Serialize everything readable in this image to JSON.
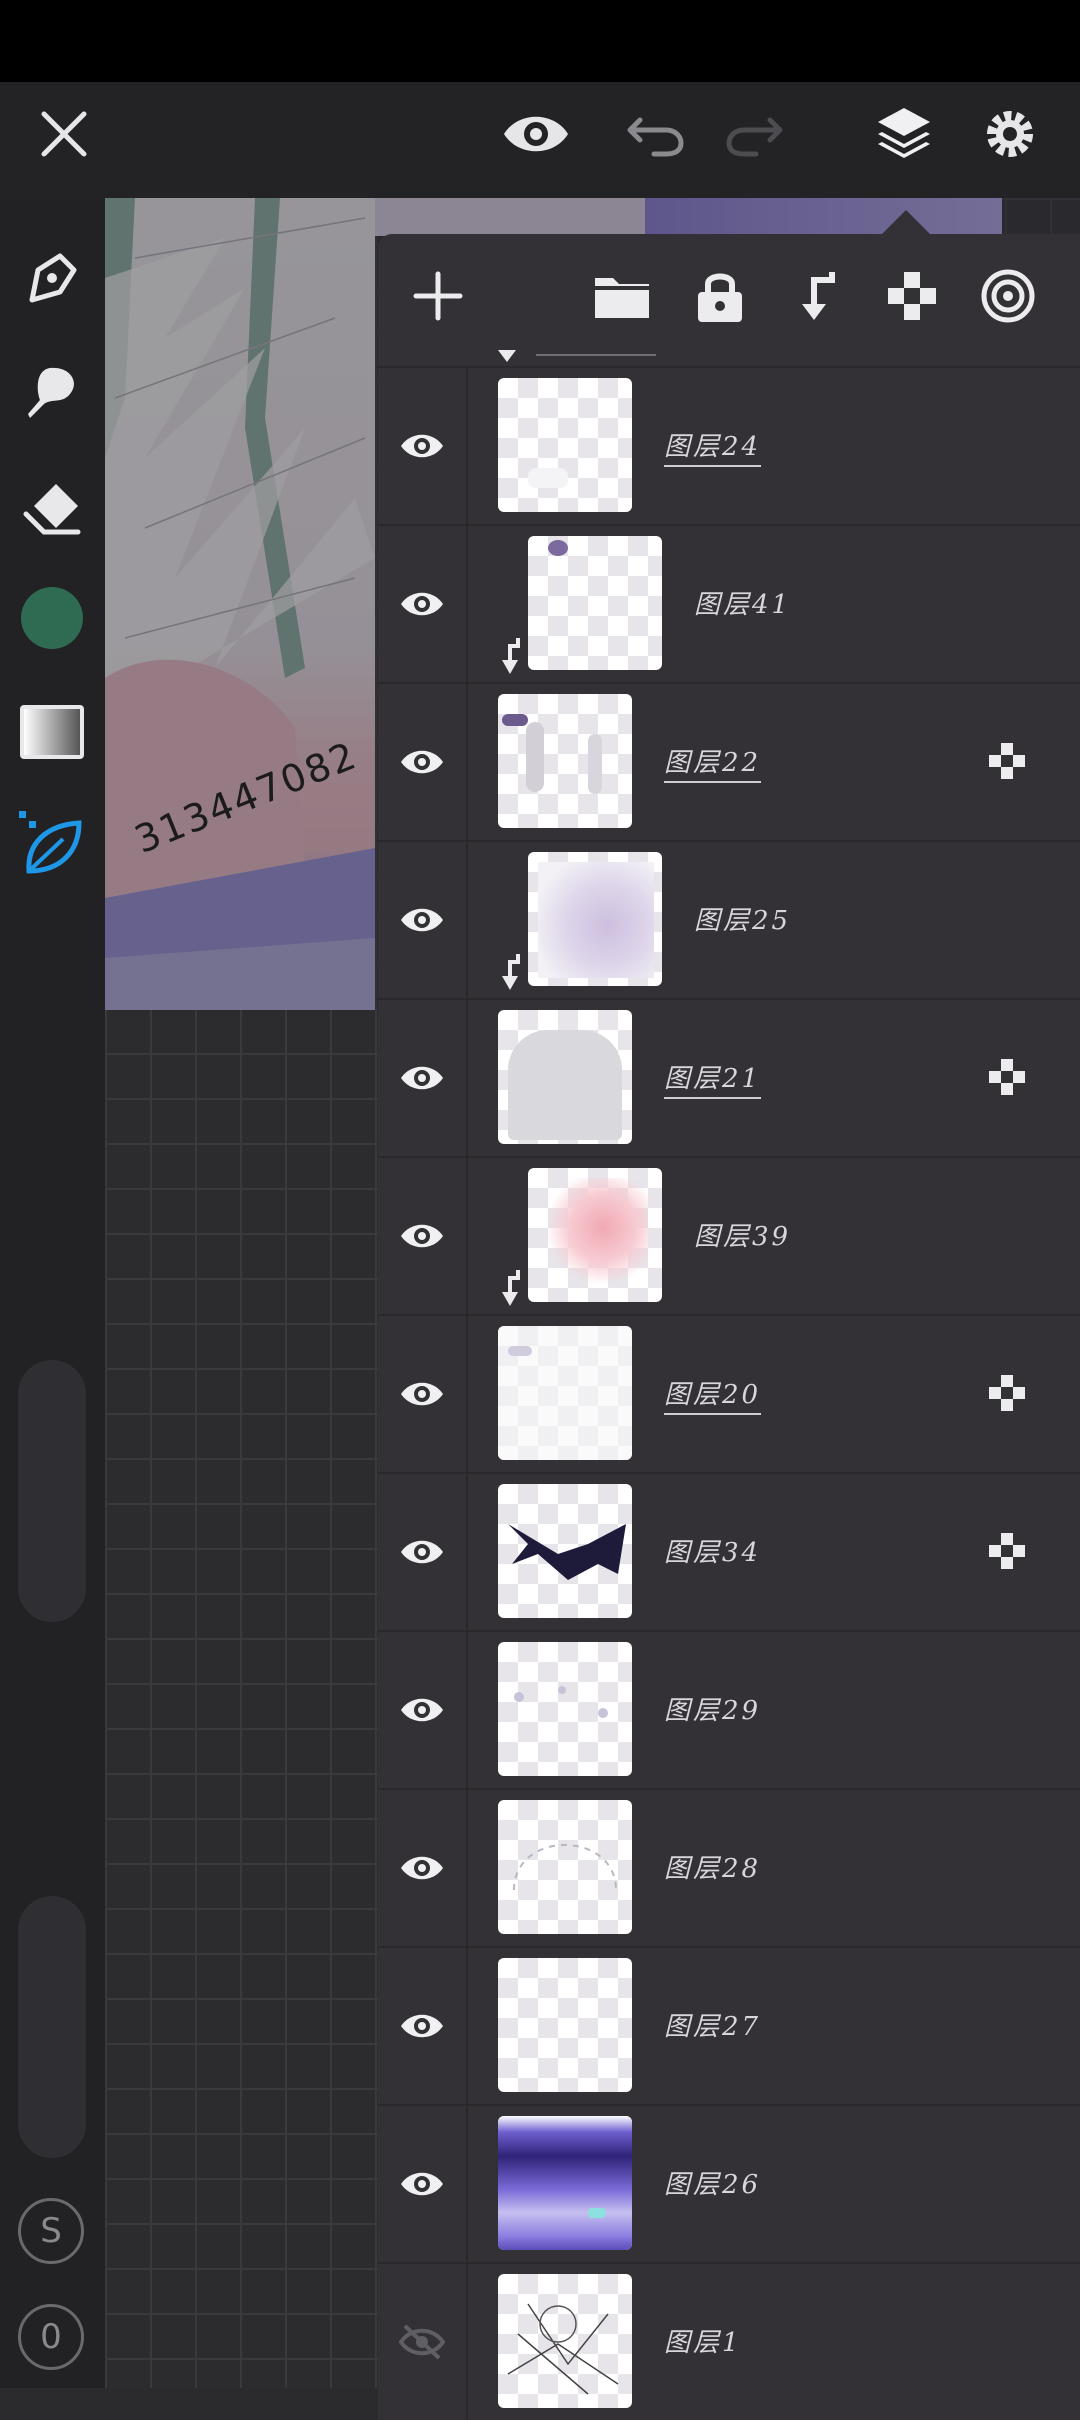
{
  "toolbar": {
    "close_icon": "close-icon",
    "preview_icon": "eye-icon",
    "undo_icon": "undo-icon",
    "redo_icon": "redo-icon",
    "layers_icon": "layers-icon",
    "settings_icon": "gear-icon"
  },
  "sidebar": {
    "tools": [
      "pen-icon",
      "brush-icon",
      "eraser-icon",
      "color-swatch",
      "gradient-icon",
      "leaf-brush-icon"
    ],
    "current_color": "#2e6b52",
    "bottom_buttons": [
      "S",
      "0"
    ]
  },
  "artwork": {
    "watermark_text": "313447082"
  },
  "layers_panel": {
    "tools": [
      "add-layer-icon",
      "folder-icon",
      "lock-icon",
      "clip-icon",
      "transparency-icon",
      "blend-mode-icon"
    ],
    "layers": [
      {
        "name": "图层24",
        "visible": true,
        "clipped": false,
        "alpha_lock": false,
        "underlined": true
      },
      {
        "name": "图层41",
        "visible": true,
        "clipped": true,
        "alpha_lock": false,
        "underlined": false
      },
      {
        "name": "图层22",
        "visible": true,
        "clipped": false,
        "alpha_lock": true,
        "underlined": true
      },
      {
        "name": "图层25",
        "visible": true,
        "clipped": true,
        "alpha_lock": false,
        "underlined": false
      },
      {
        "name": "图层21",
        "visible": true,
        "clipped": false,
        "alpha_lock": true,
        "underlined": true
      },
      {
        "name": "图层39",
        "visible": true,
        "clipped": true,
        "alpha_lock": false,
        "underlined": false
      },
      {
        "name": "图层20",
        "visible": true,
        "clipped": false,
        "alpha_lock": true,
        "underlined": true
      },
      {
        "name": "图层34",
        "visible": true,
        "clipped": false,
        "alpha_lock": true,
        "underlined": false
      },
      {
        "name": "图层29",
        "visible": true,
        "clipped": false,
        "alpha_lock": false,
        "underlined": false
      },
      {
        "name": "图层28",
        "visible": true,
        "clipped": false,
        "alpha_lock": false,
        "underlined": false
      },
      {
        "name": "图层27",
        "visible": true,
        "clipped": false,
        "alpha_lock": false,
        "underlined": false
      },
      {
        "name": "图层26",
        "visible": true,
        "clipped": false,
        "alpha_lock": false,
        "underlined": false
      },
      {
        "name": "图层1",
        "visible": false,
        "clipped": false,
        "alpha_lock": false,
        "underlined": false
      }
    ]
  }
}
